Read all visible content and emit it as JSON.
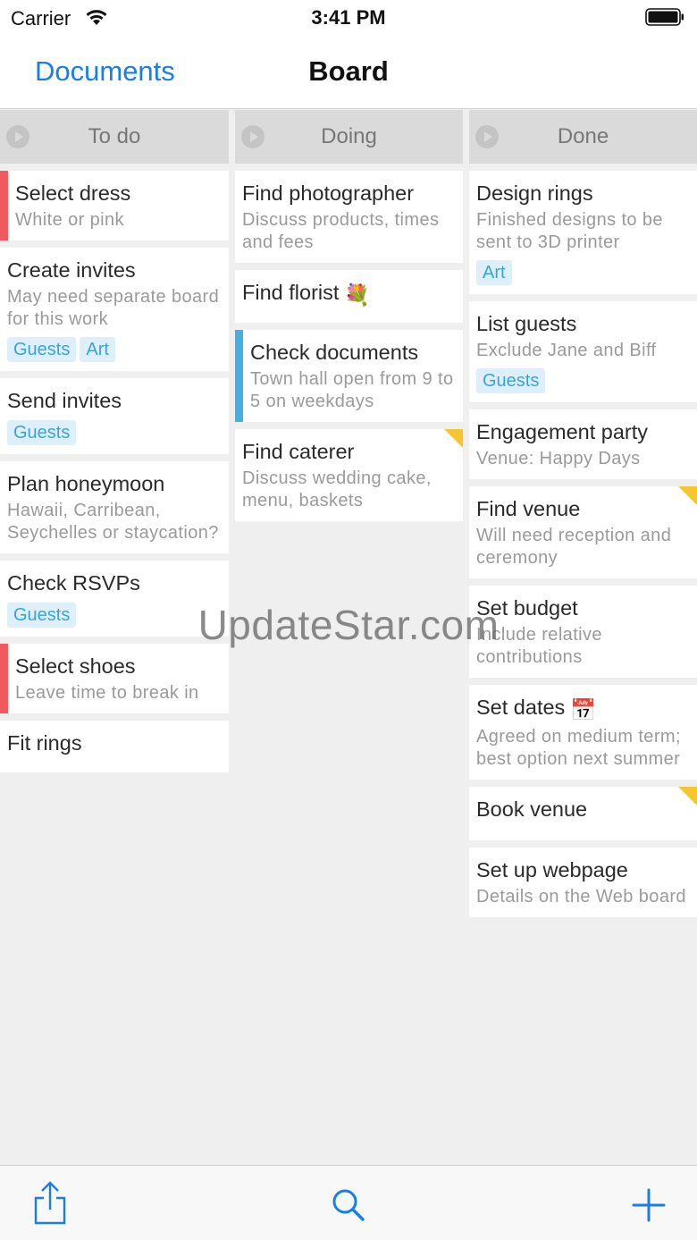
{
  "status_bar": {
    "carrier": "Carrier",
    "time": "3:41 PM"
  },
  "nav": {
    "back_label": "Documents",
    "title": "Board"
  },
  "columns": [
    {
      "title": "To do",
      "cards": [
        {
          "title": "Select dress",
          "desc": "White or pink",
          "bar": "red"
        },
        {
          "title": "Create invites",
          "desc": "May need separate board for this work",
          "tags": [
            "Guests",
            "Art"
          ]
        },
        {
          "title": "Send invites",
          "tags": [
            "Guests"
          ]
        },
        {
          "title": "Plan honeymoon",
          "desc": "Hawaii, Carribean, Seychelles or staycation?"
        },
        {
          "title": "Check RSVPs",
          "tags": [
            "Guests"
          ]
        },
        {
          "title": "Select shoes",
          "desc": "Leave time to break in",
          "bar": "red"
        },
        {
          "title": "Fit rings"
        }
      ]
    },
    {
      "title": "Doing",
      "cards": [
        {
          "title": "Find photographer",
          "desc": "Discuss products, times and fees"
        },
        {
          "title": "Find florist",
          "emoji": "💐"
        },
        {
          "title": "Check documents",
          "desc": "Town hall open from 9 to 5 on weekdays",
          "bar": "blue"
        },
        {
          "title": "Find caterer",
          "desc": "Discuss wedding cake, menu, baskets",
          "flag": true
        }
      ]
    },
    {
      "title": "Done",
      "cards": [
        {
          "title": "Design rings",
          "desc": "Finished designs to be sent to 3D printer",
          "tags": [
            "Art"
          ]
        },
        {
          "title": "List guests",
          "desc": "Exclude Jane and Biff",
          "tags": [
            "Guests"
          ]
        },
        {
          "title": "Engagement party",
          "desc": "Venue: Happy Days"
        },
        {
          "title": "Find venue",
          "desc": "Will need reception and ceremony",
          "flag": true
        },
        {
          "title": "Set budget",
          "desc": "Include relative contributions"
        },
        {
          "title": "Set dates",
          "emoji": "📅",
          "desc": "Agreed on medium term; best option next summer"
        },
        {
          "title": "Book venue",
          "flag": true
        },
        {
          "title": "Set up webpage",
          "desc": "Details on the Web board"
        }
      ]
    }
  ],
  "watermark": "UpdateStar.com",
  "colors": {
    "accent": "#1a7ee6",
    "bar_red": "#f0595e",
    "bar_blue": "#45b0e0",
    "tag_bg": "#ddf0fa",
    "tag_text": "#3aa3db",
    "flag": "#f7c52e"
  },
  "toolbar": {
    "icons": [
      "share-icon",
      "search-icon",
      "add-icon"
    ]
  }
}
